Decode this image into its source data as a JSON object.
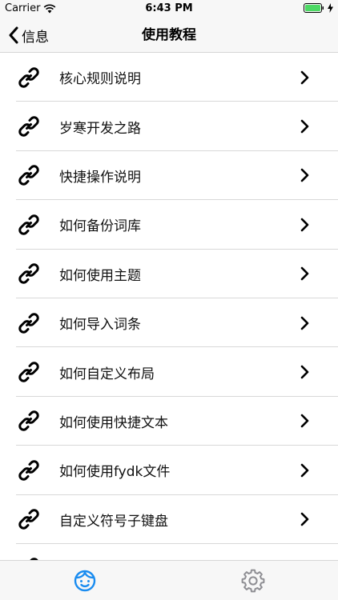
{
  "status_bar": {
    "carrier": "Carrier",
    "time": "6:43 PM"
  },
  "nav": {
    "back_label": "信息",
    "title": "使用教程"
  },
  "list": {
    "items": [
      {
        "label": "核心规则说明"
      },
      {
        "label": "岁寒开发之路"
      },
      {
        "label": "快捷操作说明"
      },
      {
        "label": "如何备份词库"
      },
      {
        "label": "如何使用主题"
      },
      {
        "label": "如何导入词条"
      },
      {
        "label": "如何自定义布局"
      },
      {
        "label": "如何使用快捷文本"
      },
      {
        "label": "如何使用fydk文件"
      },
      {
        "label": "自定义符号子键盘"
      }
    ],
    "icon": "link-icon",
    "chevron_icon": "chevron-right-icon"
  },
  "tab_bar": {
    "items": [
      {
        "icon": "face-icon",
        "active": true
      },
      {
        "icon": "gear-icon",
        "active": false
      }
    ],
    "active_color": "#1a8cf0",
    "inactive_color": "#8e8e93"
  }
}
